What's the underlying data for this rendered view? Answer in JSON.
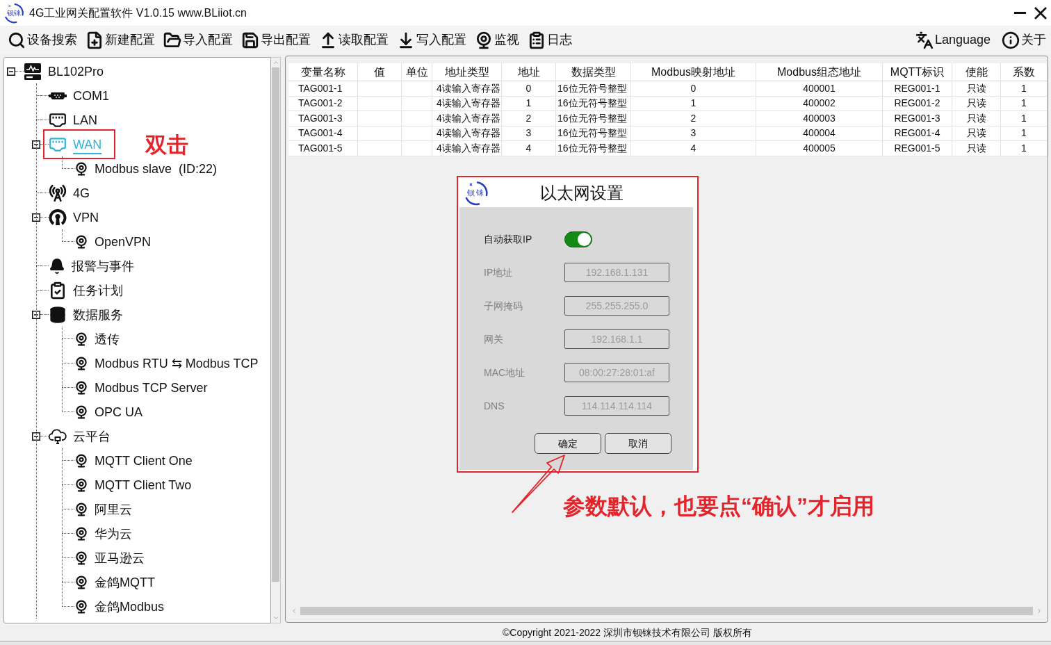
{
  "window": {
    "title": "4G工业网关配置软件 V1.0.15 www.BLiiot.cn",
    "logo_text": "钡铼"
  },
  "toolbar": {
    "left": [
      {
        "label": "设备搜索"
      },
      {
        "label": "新建配置"
      },
      {
        "label": "导入配置"
      },
      {
        "label": "导出配置"
      },
      {
        "label": "读取配置"
      },
      {
        "label": "写入配置"
      },
      {
        "label": "监视"
      },
      {
        "label": "日志"
      }
    ],
    "right": [
      {
        "label": "Language"
      },
      {
        "label": "关于"
      }
    ]
  },
  "tree": [
    {
      "label": "BL102Pro",
      "kind": "gateway",
      "expanded": true,
      "selected": false,
      "children": [
        {
          "label": "COM1",
          "kind": "serial",
          "selected": false
        },
        {
          "label": "LAN",
          "kind": "ethernet",
          "selected": false
        },
        {
          "label": "WAN",
          "kind": "ethernet",
          "expanded": true,
          "selected": true,
          "children": [
            {
              "label": "Modbus slave  (ID:22)",
              "kind": "protocol",
              "selected": false
            }
          ]
        },
        {
          "label": "4G",
          "kind": "cellular",
          "selected": false
        },
        {
          "label": "VPN",
          "kind": "vpn",
          "expanded": true,
          "selected": false,
          "children": [
            {
              "label": "OpenVPN",
              "kind": "protocol",
              "selected": false
            }
          ]
        },
        {
          "label": "报警与事件",
          "kind": "alarm",
          "selected": false
        },
        {
          "label": "任务计划",
          "kind": "schedule",
          "selected": false
        },
        {
          "label": "数据服务",
          "kind": "services",
          "expanded": true,
          "selected": false,
          "children": [
            {
              "label": "透传",
              "kind": "protocol",
              "selected": false
            },
            {
              "label": "Modbus RTU ⇆ Modbus TCP",
              "kind": "protocol",
              "selected": false
            },
            {
              "label": "Modbus TCP Server",
              "kind": "protocol",
              "selected": false
            },
            {
              "label": "OPC UA",
              "kind": "protocol",
              "selected": false
            }
          ]
        },
        {
          "label": "云平台",
          "kind": "cloud",
          "expanded": true,
          "selected": false,
          "children": [
            {
              "label": "MQTT Client One",
              "kind": "protocol",
              "selected": false
            },
            {
              "label": "MQTT Client Two",
              "kind": "protocol",
              "selected": false
            },
            {
              "label": "阿里云",
              "kind": "protocol",
              "selected": false
            },
            {
              "label": "华为云",
              "kind": "protocol",
              "selected": false
            },
            {
              "label": "亚马逊云",
              "kind": "protocol",
              "selected": false
            },
            {
              "label": "金鸽MQTT",
              "kind": "protocol",
              "selected": false
            },
            {
              "label": "金鸽Modbus",
              "kind": "protocol",
              "selected": false
            }
          ]
        }
      ]
    }
  ],
  "table": {
    "columns": [
      "变量名称",
      "值",
      "单位",
      "地址类型",
      "地址",
      "数据类型",
      "Modbus映射地址",
      "Modbus组态地址",
      "MQTT标识",
      "使能",
      "系数"
    ],
    "rows": [
      {
        "cells": [
          "TAG001-1",
          null,
          null,
          "4读输入寄存器",
          "0",
          "16位无符号整型",
          "0",
          "400001",
          "REG001-1",
          "只读",
          "1"
        ]
      },
      {
        "cells": [
          "TAG001-2",
          null,
          null,
          "4读输入寄存器",
          "1",
          "16位无符号整型",
          "1",
          "400002",
          "REG001-2",
          "只读",
          "1"
        ]
      },
      {
        "cells": [
          "TAG001-3",
          null,
          null,
          "4读输入寄存器",
          "2",
          "16位无符号整型",
          "2",
          "400003",
          "REG001-3",
          "只读",
          "1"
        ]
      },
      {
        "cells": [
          "TAG001-4",
          null,
          null,
          "4读输入寄存器",
          "3",
          "16位无符号整型",
          "3",
          "400004",
          "REG001-4",
          "只读",
          "1"
        ]
      },
      {
        "cells": [
          "TAG001-5",
          null,
          null,
          "4读输入寄存器",
          "4",
          "16位无符号整型",
          "4",
          "400005",
          "REG001-5",
          "只读",
          "1"
        ]
      }
    ]
  },
  "dialog": {
    "logo_text": "钡铼",
    "title": "以太网设置",
    "toggle": {
      "label": "自动获取IP",
      "on": true
    },
    "fields": [
      {
        "label": "IP地址",
        "value": "192.168.1.131",
        "disabled": true
      },
      {
        "label": "子网掩码",
        "value": "255.255.255.0",
        "disabled": true
      },
      {
        "label": "网关",
        "value": "192.168.1.1",
        "disabled": true
      },
      {
        "label": "MAC地址",
        "value": "08:00:27:28:01:af",
        "disabled": true
      },
      {
        "label": "DNS",
        "value": "114.114.114.114",
        "disabled": true
      }
    ],
    "buttons": [
      "确定",
      "取消"
    ]
  },
  "annotations": {
    "tree_note": "双击",
    "dialog_note": "参数默认，也要点“确认”才启用"
  },
  "status_bar": {
    "copyright": "©Copyright 2021-2022 深圳市钡铼技术有限公司 版权所有"
  }
}
